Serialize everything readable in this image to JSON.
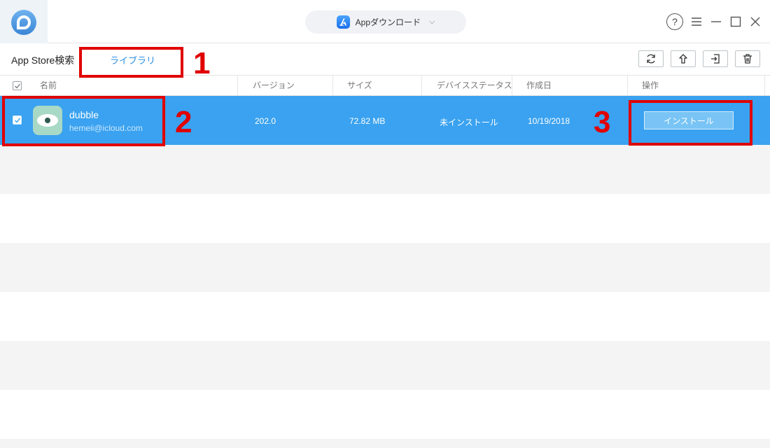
{
  "titlebar": {
    "mode_label": "Appダウンロード",
    "help_symbol": "?"
  },
  "tabs": {
    "search_label": "App Store検索",
    "library_label": "ライブラリ"
  },
  "table": {
    "columns": [
      "名前",
      "バージョン",
      "サイズ",
      "デバイスステータス",
      "作成日",
      "操作"
    ],
    "rows": [
      {
        "name": "dubble",
        "account": "hemeii@icloud.com",
        "version": "202.0",
        "size": "72.82 MB",
        "status": "未インストール",
        "date": "10/19/2018",
        "action_label": "インストール",
        "selected": true,
        "icon": "eye-app-icon"
      }
    ]
  },
  "annotations": [
    "1",
    "2",
    "3"
  ],
  "colors": {
    "accent": "#2a8fe0",
    "selected_row": "#3aa2f0",
    "annotation": "#e00000"
  }
}
